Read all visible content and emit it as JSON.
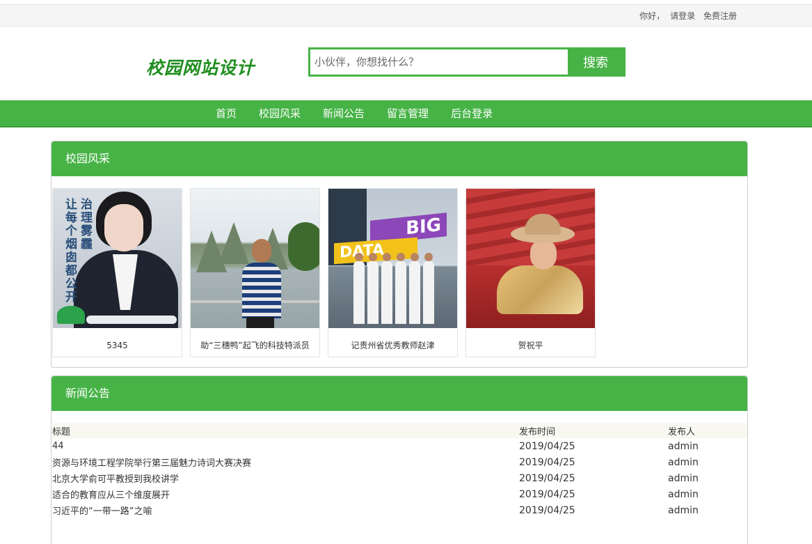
{
  "topbar": {
    "greeting": "你好，",
    "login": "请登录",
    "register": "免费注册"
  },
  "logo": {
    "text": "校园网站设计"
  },
  "search": {
    "placeholder": "小伙伴，你想找什么？",
    "button": "搜索"
  },
  "nav": {
    "items": [
      {
        "label": "首页"
      },
      {
        "label": "校园风采"
      },
      {
        "label": "新闻公告"
      },
      {
        "label": "留言管理"
      },
      {
        "label": "后台登录"
      }
    ]
  },
  "campus": {
    "title": "校园风采",
    "photos": [
      {
        "caption": "5345",
        "photo_text": "治理雾霾让每个烟囱都公开"
      },
      {
        "caption": "助“三穗鸭”起飞的科技特派员"
      },
      {
        "caption": "记贵州省优秀教师赵津",
        "photo_text": "BIG DATA"
      },
      {
        "caption": "贺祝平"
      }
    ]
  },
  "news": {
    "title": "新闻公告",
    "columns": [
      "标题",
      "发布时间",
      "发布人"
    ],
    "rows": [
      {
        "title": "44",
        "date": "2019/04/25",
        "author": "admin"
      },
      {
        "title": "资源与环境工程学院举行第三届魅力诗词大赛决赛",
        "date": "2019/04/25",
        "author": "admin"
      },
      {
        "title": "北京大学俞可平教授到我校讲学",
        "date": "2019/04/25",
        "author": "admin"
      },
      {
        "title": "适合的教育应从三个维度展开",
        "date": "2019/04/25",
        "author": "admin"
      },
      {
        "title": "习近平的“一带一路”之喻",
        "date": "2019/04/25",
        "author": "admin"
      }
    ]
  },
  "colors": {
    "accent": "#47b347",
    "logo": "#1f8e1f",
    "table_header_bg": "#f8f8f1"
  }
}
